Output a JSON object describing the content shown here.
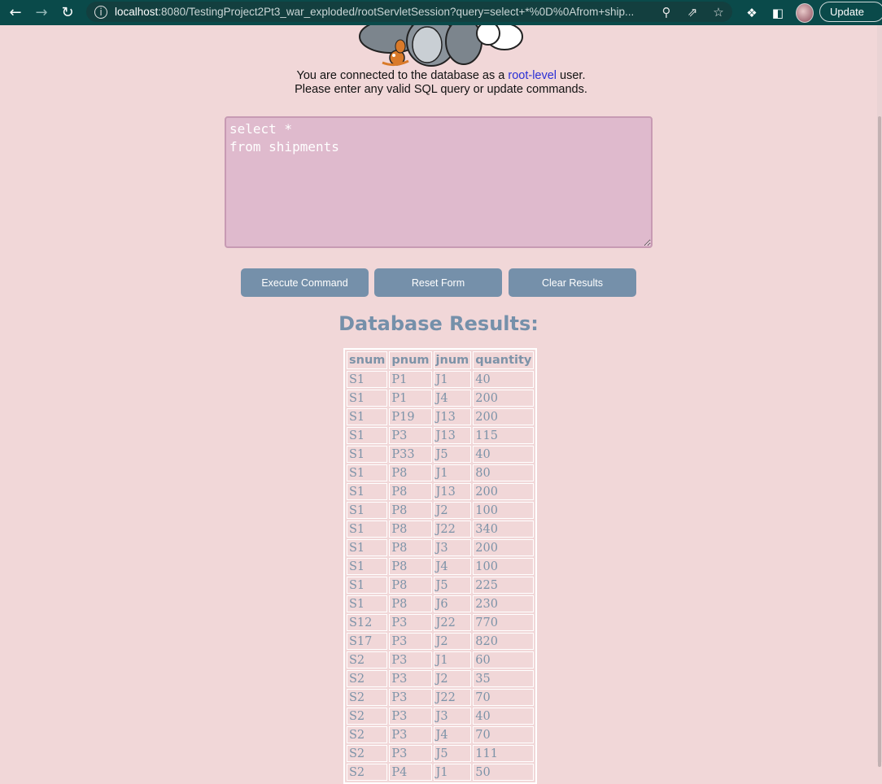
{
  "browser": {
    "url_host": "localhost",
    "url_rest": ":8080/TestingProject2Pt3_war_exploded/rootServletSession?query=select+*%0D%0Afrom+ship...",
    "update_label": "Update"
  },
  "intro": {
    "line1_before": "You are connected to the database as a ",
    "line1_link": "root-level",
    "line1_after": " user.",
    "line2": "Please enter any valid SQL query or update commands."
  },
  "query": {
    "value": "select *\nfrom shipments"
  },
  "buttons": {
    "execute": "Execute Command",
    "reset": "Reset Form",
    "clear": "Clear Results"
  },
  "results": {
    "title": "Database Results:",
    "columns": [
      "snum",
      "pnum",
      "jnum",
      "quantity"
    ],
    "rows": [
      [
        "S1",
        "P1",
        "J1",
        "40"
      ],
      [
        "S1",
        "P1",
        "J4",
        "200"
      ],
      [
        "S1",
        "P19",
        "J13",
        "200"
      ],
      [
        "S1",
        "P3",
        "J13",
        "115"
      ],
      [
        "S1",
        "P33",
        "J5",
        "40"
      ],
      [
        "S1",
        "P8",
        "J1",
        "80"
      ],
      [
        "S1",
        "P8",
        "J13",
        "200"
      ],
      [
        "S1",
        "P8",
        "J2",
        "100"
      ],
      [
        "S1",
        "P8",
        "J22",
        "340"
      ],
      [
        "S1",
        "P8",
        "J3",
        "200"
      ],
      [
        "S1",
        "P8",
        "J4",
        "100"
      ],
      [
        "S1",
        "P8",
        "J5",
        "225"
      ],
      [
        "S1",
        "P8",
        "J6",
        "230"
      ],
      [
        "S12",
        "P3",
        "J22",
        "770"
      ],
      [
        "S17",
        "P3",
        "J2",
        "820"
      ],
      [
        "S2",
        "P3",
        "J1",
        "60"
      ],
      [
        "S2",
        "P3",
        "J2",
        "35"
      ],
      [
        "S2",
        "P3",
        "J22",
        "70"
      ],
      [
        "S2",
        "P3",
        "J3",
        "40"
      ],
      [
        "S2",
        "P3",
        "J4",
        "70"
      ],
      [
        "S2",
        "P3",
        "J5",
        "111"
      ],
      [
        "S2",
        "P4",
        "J1",
        "50"
      ]
    ]
  }
}
